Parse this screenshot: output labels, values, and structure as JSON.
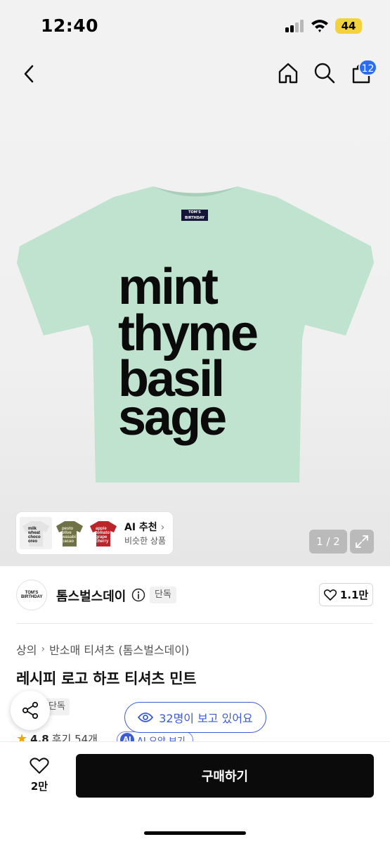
{
  "status_bar": {
    "time": "12:40",
    "battery": "44"
  },
  "header": {
    "cart_count": "12"
  },
  "product_image": {
    "tee_lines": [
      "mint",
      "thyme",
      "basil",
      "sage"
    ],
    "tee_label": "TOM'S BIRTHDAY",
    "tee_color": "#bfe3cf",
    "counter": "1 / 2"
  },
  "ai_recommend": {
    "title": "AI 추천",
    "subtitle": "비슷한 상품",
    "thumbs": [
      {
        "text": "milk wheat choco oreo",
        "bg": "#f1f1f1",
        "shirt": "#e4e4e4",
        "ink": "#111111"
      },
      {
        "text": "pesto olive wasabi cacao",
        "bg": "#ffffff",
        "shirt": "#6f7246",
        "ink": "#e9e4c8"
      },
      {
        "text": "apple tomato grape cherry",
        "bg": "#ffffff",
        "shirt": "#b9252a",
        "ink": "#f2e8e8"
      }
    ]
  },
  "brand": {
    "logo_text": "TOM'S BIRTHDAY",
    "name": "톰스벌스데이",
    "tag": "단독",
    "likes": "1.1만"
  },
  "product": {
    "breadcrumb": [
      "상의",
      "반소매 티셔츠 (톰스벌스데이)"
    ],
    "title": "레시피 로고 하프 티셔츠 민트",
    "tag": "단독",
    "rating": "4.8",
    "reviews": "후기 54개",
    "ai_summary": "AI 요약 보기",
    "ai_badge": "AI"
  },
  "viewers": "32명이 보고 있어요",
  "bottom": {
    "wish_count": "2만",
    "buy_label": "구매하기"
  }
}
